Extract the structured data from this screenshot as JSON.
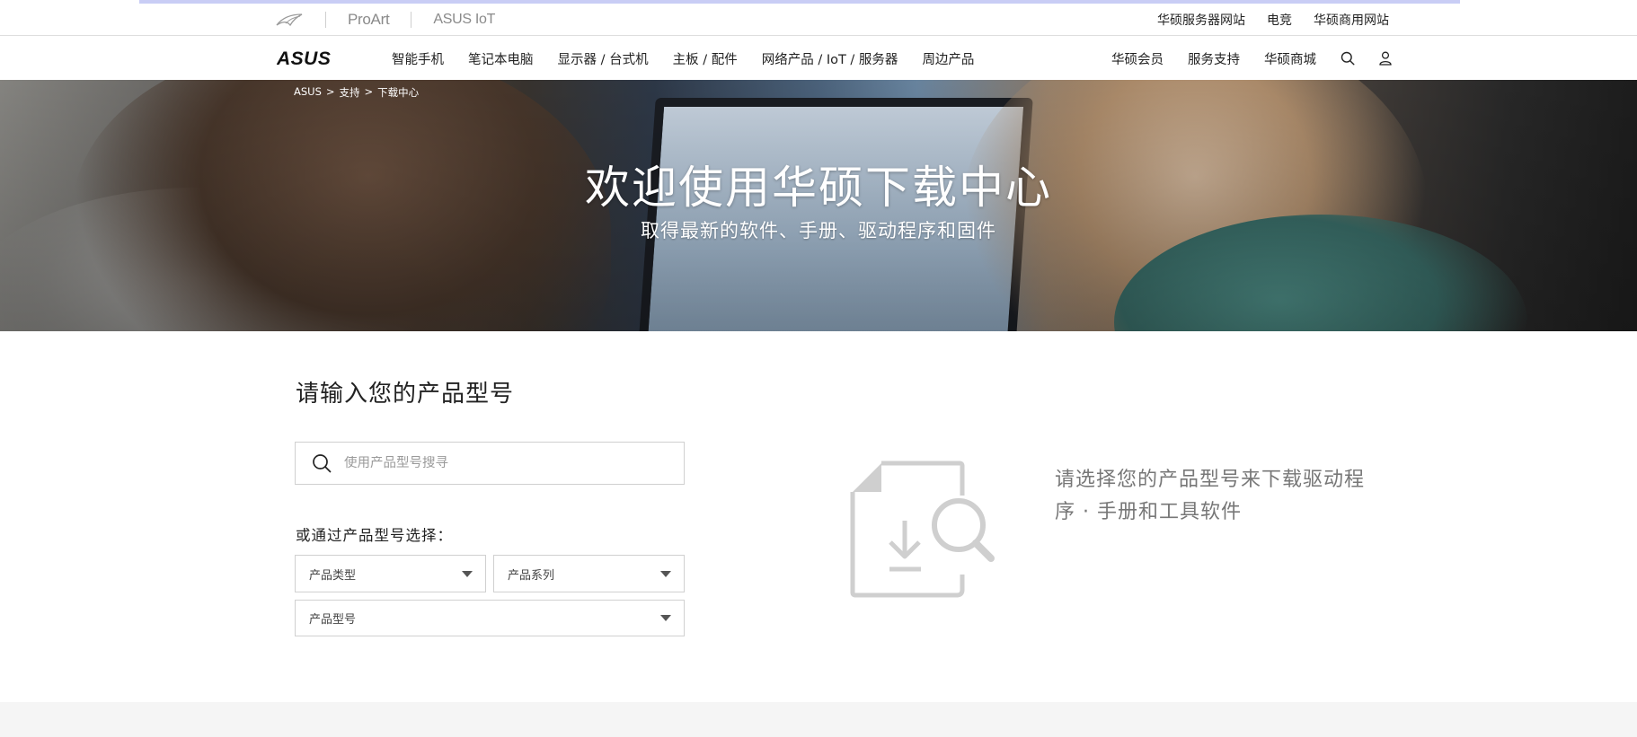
{
  "brandbar": {
    "brands": [
      {
        "name": "rog",
        "label": ""
      },
      {
        "name": "proart",
        "label": "ProArt"
      },
      {
        "name": "asus-iot",
        "label": "ASUS IoT"
      }
    ],
    "sites": [
      "华硕服务器网站",
      "电竞",
      "华硕商用网站"
    ]
  },
  "nav": {
    "logo": "ASUS",
    "items": [
      "智能手机",
      "笔记本电脑",
      "显示器 / 台式机",
      "主板 / 配件",
      "网络产品 / IoT / 服务器",
      "周边产品"
    ],
    "right": [
      "华硕会员",
      "服务支持",
      "华硕商城"
    ]
  },
  "hero": {
    "breadcrumb": [
      "ASUS",
      "支持",
      "下载中心"
    ],
    "breadcrumb_sep": ">",
    "title": "欢迎使用华硕下载中心",
    "subtitle": "取得最新的软件、手册、驱动程序和固件"
  },
  "main": {
    "section_title": "请输入您的产品型号",
    "search_placeholder": "使用产品型号搜寻",
    "search_value": "",
    "or_label": "或通过产品型号选择：",
    "selects": {
      "type": "产品类型",
      "series": "产品系列",
      "model": "产品型号"
    },
    "hint": "请选择您的产品型号来下载驱动程序 · 手册和工具软件"
  },
  "colors": {
    "accent_line": "#c9cdf5",
    "text": "#222222",
    "muted": "#777777",
    "border": "#d0d0d0"
  },
  "icons": [
    "rog-logo-icon",
    "asus-logo",
    "search-icon",
    "user-icon",
    "download-search-illustration-icon",
    "dropdown-caret-icon"
  ]
}
